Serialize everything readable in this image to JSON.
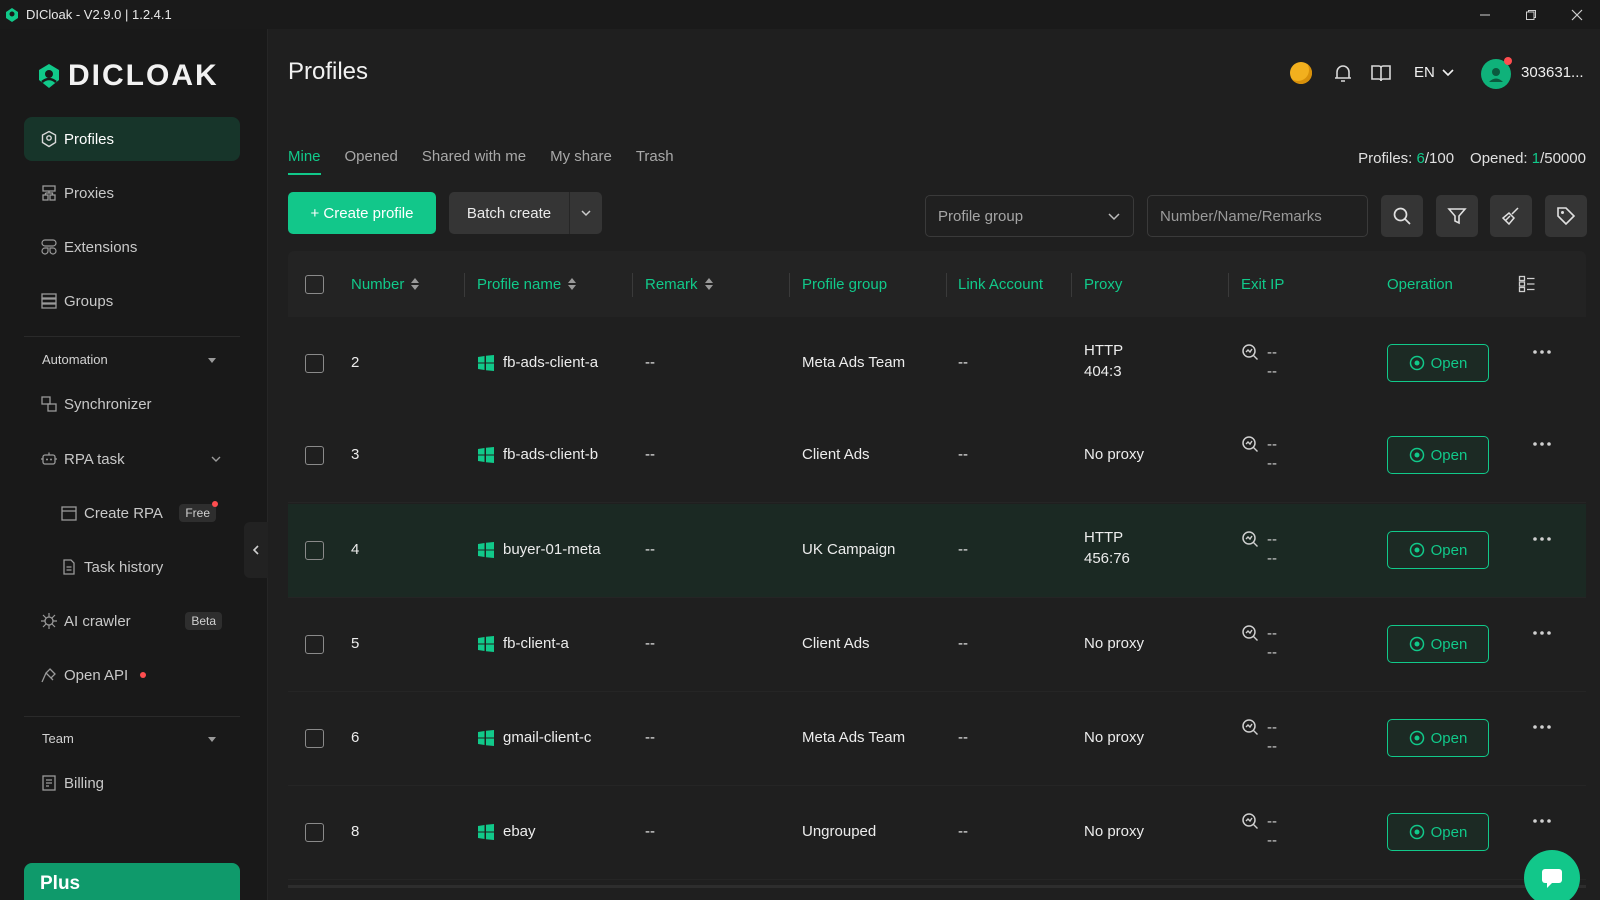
{
  "window": {
    "title": "DICloak - V2.9.0 | 1.2.4.1",
    "controls": [
      "minimize-icon",
      "restore-icon",
      "close-icon"
    ]
  },
  "brand": {
    "name": "DICLOAK",
    "accent": "#11c98a"
  },
  "sidebar": {
    "items": [
      {
        "label": "Profiles",
        "icon": "profiles-icon",
        "active": true
      },
      {
        "label": "Proxies",
        "icon": "proxies-icon"
      },
      {
        "label": "Extensions",
        "icon": "extensions-icon"
      },
      {
        "label": "Groups",
        "icon": "groups-icon"
      }
    ],
    "automation": {
      "label": "Automation",
      "items": [
        {
          "label": "Synchronizer",
          "icon": "synchronizer-icon"
        },
        {
          "label": "RPA task",
          "icon": "robot-icon"
        },
        {
          "label": "Create RPA",
          "icon": "create-rpa-icon",
          "badge": "Free"
        },
        {
          "label": "Task history",
          "icon": "task-history-icon"
        },
        {
          "label": "AI crawler",
          "icon": "crawler-icon",
          "badge": "Beta"
        },
        {
          "label": "Open API",
          "icon": "api-icon"
        }
      ]
    },
    "team": {
      "label": "Team",
      "items": [
        {
          "label": "Billing",
          "icon": "billing-icon"
        }
      ]
    },
    "plan": {
      "label": "Plus"
    }
  },
  "header": {
    "title": "Profiles",
    "language": "EN",
    "user": "303631..."
  },
  "tabs": [
    "Mine",
    "Opened",
    "Shared with me",
    "My share",
    "Trash"
  ],
  "stats": {
    "profiles_label": "Profiles:",
    "profiles_used": "6",
    "profiles_total": "/100",
    "opened_label": "Opened:",
    "opened_used": "1",
    "opened_total": "/50000"
  },
  "toolbar": {
    "create_label": "+ Create profile",
    "batch_label": "Batch create",
    "group_select": "Profile group",
    "search_placeholder": "Number/Name/Remarks"
  },
  "table": {
    "columns": [
      "Number",
      "Profile name",
      "Remark",
      "Profile group",
      "Link Account",
      "Proxy",
      "Exit IP",
      "Operation"
    ],
    "open_label": "Open",
    "rows": [
      {
        "number": "2",
        "name": "fb-ads-client-a",
        "remark": "--",
        "group": "Meta Ads Team",
        "link": "--",
        "proxy_line1": "HTTP",
        "proxy_line2": "404:3",
        "ip1": "--",
        "ip2": "--"
      },
      {
        "number": "3",
        "name": "fb-ads-client-b",
        "remark": "--",
        "group": "Client Ads",
        "link": "--",
        "proxy_line1": "No proxy",
        "proxy_line2": "",
        "ip1": "--",
        "ip2": "--"
      },
      {
        "number": "4",
        "name": "buyer-01-meta",
        "remark": "--",
        "group": "UK Campaign",
        "link": "--",
        "proxy_line1": "HTTP",
        "proxy_line2": "456:76",
        "ip1": "--",
        "ip2": "--"
      },
      {
        "number": "5",
        "name": "fb-client-a",
        "remark": "--",
        "group": "Client Ads",
        "link": "--",
        "proxy_line1": "No proxy",
        "proxy_line2": "",
        "ip1": "--",
        "ip2": "--"
      },
      {
        "number": "6",
        "name": "gmail-client-c",
        "remark": "--",
        "group": "Meta Ads Team",
        "link": "--",
        "proxy_line1": "No proxy",
        "proxy_line2": "",
        "ip1": "--",
        "ip2": "--"
      },
      {
        "number": "8",
        "name": "ebay",
        "remark": "--",
        "group": "Ungrouped",
        "link": "--",
        "proxy_line1": "No proxy",
        "proxy_line2": "",
        "ip1": "--",
        "ip2": "--"
      }
    ]
  }
}
